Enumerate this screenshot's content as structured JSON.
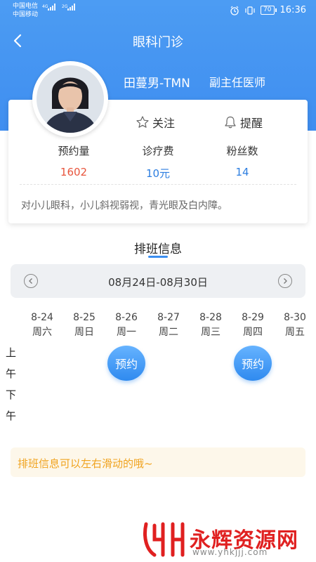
{
  "status_bar": {
    "carrier1": "中国电信",
    "carrier2": "中国移动",
    "net1": "4G",
    "net2": "2G",
    "battery": "70",
    "time": "16:36"
  },
  "nav": {
    "title": "眼科门诊",
    "back_icon": "chevron-left-icon"
  },
  "doctor": {
    "name": "田蔓男-TMN",
    "title": "副主任医师",
    "follow_label": "关注",
    "remind_label": "提醒",
    "stats": [
      {
        "label": "预约量",
        "value": "1602",
        "color": "#e8553d"
      },
      {
        "label": "诊疗费",
        "value": "10元",
        "color": "#2d7ee0"
      },
      {
        "label": "粉丝数",
        "value": "14",
        "color": "#2d7ee0"
      }
    ],
    "intro": "对小儿眼科，小儿斜视弱视，青光眼及白内障。"
  },
  "schedule": {
    "section_title": "排班信息",
    "week_range": "08月24日-08月30日",
    "days": [
      {
        "date": "8-24",
        "weekday": "周六"
      },
      {
        "date": "8-25",
        "weekday": "周日"
      },
      {
        "date": "8-26",
        "weekday": "周一"
      },
      {
        "date": "8-27",
        "weekday": "周二"
      },
      {
        "date": "8-28",
        "weekday": "周三"
      },
      {
        "date": "8-29",
        "weekday": "周四"
      },
      {
        "date": "8-30",
        "weekday": "周五"
      }
    ],
    "periods": {
      "am": [
        "上",
        "午"
      ],
      "pm": [
        "下",
        "午"
      ]
    },
    "book_label": "预约",
    "book_slots": [
      "8-26 上午",
      "8-29 上午"
    ],
    "tip": "排班信息可以左右滑动的哦~"
  },
  "watermark": {
    "text": "永辉资源网",
    "url": "www.yhkjjj.com"
  },
  "colors": {
    "primary": "#3f8ef0",
    "accent_red": "#e8553d",
    "tip": "#f0a31f"
  }
}
